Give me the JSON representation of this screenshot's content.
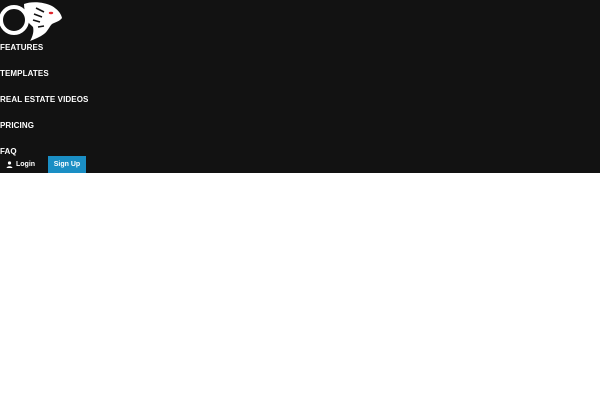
{
  "header": {
    "logo_icon": "tiger-head-logo-icon",
    "nav": [
      {
        "label": "FEATURES"
      },
      {
        "label": "TEMPLATES"
      },
      {
        "label": "REAL ESTATE VIDEOS"
      },
      {
        "label": "PRICING"
      },
      {
        "label": "FAQ"
      }
    ],
    "login_label": "Login",
    "login_icon": "user-icon",
    "signup_label": "Sign Up"
  },
  "colors": {
    "header_bg": "#121212",
    "accent": "#1a8ec4",
    "logo_eye": "#e0262d"
  }
}
